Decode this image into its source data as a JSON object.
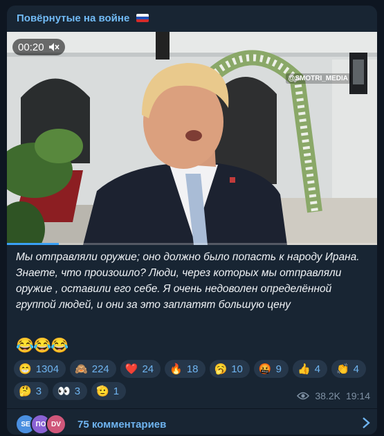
{
  "channel": {
    "title": "Повёрнутые на войне",
    "flag_icon": "russia-flag-icon"
  },
  "video": {
    "time": "00:20",
    "mute_icon": "muted-speaker-icon",
    "watermark": "@SMOTRI_MEDIA",
    "progress": 0.14
  },
  "post": {
    "caption": "Мы отправляли оружие; оно должно было попасть к народу Ирана. Знаете, что произошло? Люди, через которых мы отправляли оружие , оставили его себе. Я очень недоволен определённой группой людей, и они за это заплатят большую цену",
    "emoji_line": "😂😂😂"
  },
  "reactions": [
    {
      "emoji": "😁",
      "count": "1304"
    },
    {
      "emoji": "🙈",
      "count": "224"
    },
    {
      "emoji": "❤️",
      "count": "24"
    },
    {
      "emoji": "🔥",
      "count": "18"
    },
    {
      "emoji": "🥱",
      "count": "10"
    },
    {
      "emoji": "🤬",
      "count": "9"
    },
    {
      "emoji": "👍",
      "count": "4"
    },
    {
      "emoji": "👏",
      "count": "4"
    },
    {
      "emoji": "🤔",
      "count": "3"
    },
    {
      "emoji": "👀",
      "count": "3"
    },
    {
      "emoji": "🫡",
      "count": "1"
    }
  ],
  "meta": {
    "views": "38.2K",
    "time": "19:14",
    "views_icon": "eye-icon"
  },
  "comments": {
    "label": "75 комментариев",
    "avatars": [
      {
        "text": "SE",
        "color": "#4a8fe0"
      },
      {
        "text": "ПО",
        "color": "#8a62d4"
      },
      {
        "text": "DV",
        "color": "#d0577a"
      }
    ],
    "chevron_icon": "chevron-right-icon"
  }
}
